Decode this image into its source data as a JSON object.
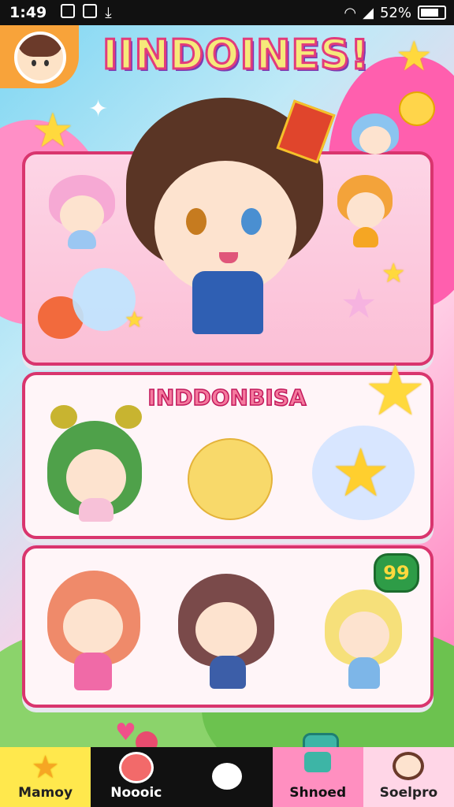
{
  "status_bar": {
    "time": "1:49",
    "battery": "52%"
  },
  "header": {
    "title": "IINDOINES!"
  },
  "section2": {
    "title": "INDDONBISA"
  },
  "bottom_nav": {
    "items": [
      {
        "label": "Mamoy",
        "icon": "star-icon"
      },
      {
        "label": "Noooic",
        "icon": "character-icon"
      },
      {
        "label": "",
        "icon": "home-circle-icon"
      },
      {
        "label": "Shnoed",
        "icon": "shop-icon"
      },
      {
        "label": "Soelpro",
        "icon": "profile-icon"
      }
    ]
  },
  "speech_bubble": {
    "text": "99"
  },
  "colors": {
    "accent_pink": "#d9356e",
    "title_fill": "#f6e97a",
    "nav_yellow": "#ffe84d"
  }
}
